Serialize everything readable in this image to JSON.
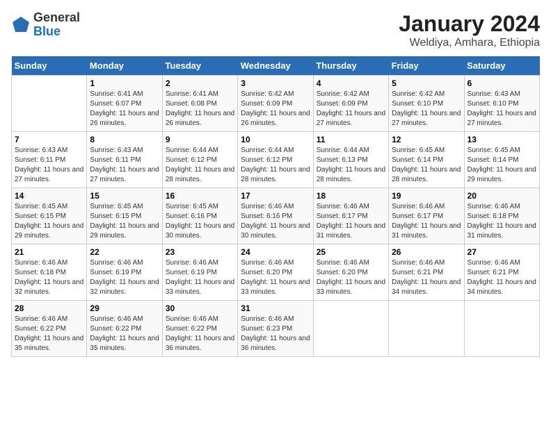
{
  "logo": {
    "general": "General",
    "blue": "Blue"
  },
  "title": "January 2024",
  "subtitle": "Weldiya, Amhara, Ethiopia",
  "days_of_week": [
    "Sunday",
    "Monday",
    "Tuesday",
    "Wednesday",
    "Thursday",
    "Friday",
    "Saturday"
  ],
  "weeks": [
    [
      {
        "day": "",
        "sunrise": "",
        "sunset": "",
        "daylight": ""
      },
      {
        "day": "1",
        "sunrise": "Sunrise: 6:41 AM",
        "sunset": "Sunset: 6:07 PM",
        "daylight": "Daylight: 11 hours and 26 minutes."
      },
      {
        "day": "2",
        "sunrise": "Sunrise: 6:41 AM",
        "sunset": "Sunset: 6:08 PM",
        "daylight": "Daylight: 11 hours and 26 minutes."
      },
      {
        "day": "3",
        "sunrise": "Sunrise: 6:42 AM",
        "sunset": "Sunset: 6:09 PM",
        "daylight": "Daylight: 11 hours and 26 minutes."
      },
      {
        "day": "4",
        "sunrise": "Sunrise: 6:42 AM",
        "sunset": "Sunset: 6:09 PM",
        "daylight": "Daylight: 11 hours and 27 minutes."
      },
      {
        "day": "5",
        "sunrise": "Sunrise: 6:42 AM",
        "sunset": "Sunset: 6:10 PM",
        "daylight": "Daylight: 11 hours and 27 minutes."
      },
      {
        "day": "6",
        "sunrise": "Sunrise: 6:43 AM",
        "sunset": "Sunset: 6:10 PM",
        "daylight": "Daylight: 11 hours and 27 minutes."
      }
    ],
    [
      {
        "day": "7",
        "sunrise": "Sunrise: 6:43 AM",
        "sunset": "Sunset: 6:11 PM",
        "daylight": "Daylight: 11 hours and 27 minutes."
      },
      {
        "day": "8",
        "sunrise": "Sunrise: 6:43 AM",
        "sunset": "Sunset: 6:11 PM",
        "daylight": "Daylight: 11 hours and 27 minutes."
      },
      {
        "day": "9",
        "sunrise": "Sunrise: 6:44 AM",
        "sunset": "Sunset: 6:12 PM",
        "daylight": "Daylight: 11 hours and 28 minutes."
      },
      {
        "day": "10",
        "sunrise": "Sunrise: 6:44 AM",
        "sunset": "Sunset: 6:12 PM",
        "daylight": "Daylight: 11 hours and 28 minutes."
      },
      {
        "day": "11",
        "sunrise": "Sunrise: 6:44 AM",
        "sunset": "Sunset: 6:13 PM",
        "daylight": "Daylight: 11 hours and 28 minutes."
      },
      {
        "day": "12",
        "sunrise": "Sunrise: 6:45 AM",
        "sunset": "Sunset: 6:14 PM",
        "daylight": "Daylight: 11 hours and 28 minutes."
      },
      {
        "day": "13",
        "sunrise": "Sunrise: 6:45 AM",
        "sunset": "Sunset: 6:14 PM",
        "daylight": "Daylight: 11 hours and 29 minutes."
      }
    ],
    [
      {
        "day": "14",
        "sunrise": "Sunrise: 6:45 AM",
        "sunset": "Sunset: 6:15 PM",
        "daylight": "Daylight: 11 hours and 29 minutes."
      },
      {
        "day": "15",
        "sunrise": "Sunrise: 6:45 AM",
        "sunset": "Sunset: 6:15 PM",
        "daylight": "Daylight: 11 hours and 29 minutes."
      },
      {
        "day": "16",
        "sunrise": "Sunrise: 6:45 AM",
        "sunset": "Sunset: 6:16 PM",
        "daylight": "Daylight: 11 hours and 30 minutes."
      },
      {
        "day": "17",
        "sunrise": "Sunrise: 6:46 AM",
        "sunset": "Sunset: 6:16 PM",
        "daylight": "Daylight: 11 hours and 30 minutes."
      },
      {
        "day": "18",
        "sunrise": "Sunrise: 6:46 AM",
        "sunset": "Sunset: 6:17 PM",
        "daylight": "Daylight: 11 hours and 31 minutes."
      },
      {
        "day": "19",
        "sunrise": "Sunrise: 6:46 AM",
        "sunset": "Sunset: 6:17 PM",
        "daylight": "Daylight: 11 hours and 31 minutes."
      },
      {
        "day": "20",
        "sunrise": "Sunrise: 6:46 AM",
        "sunset": "Sunset: 6:18 PM",
        "daylight": "Daylight: 11 hours and 31 minutes."
      }
    ],
    [
      {
        "day": "21",
        "sunrise": "Sunrise: 6:46 AM",
        "sunset": "Sunset: 6:18 PM",
        "daylight": "Daylight: 11 hours and 32 minutes."
      },
      {
        "day": "22",
        "sunrise": "Sunrise: 6:46 AM",
        "sunset": "Sunset: 6:19 PM",
        "daylight": "Daylight: 11 hours and 32 minutes."
      },
      {
        "day": "23",
        "sunrise": "Sunrise: 6:46 AM",
        "sunset": "Sunset: 6:19 PM",
        "daylight": "Daylight: 11 hours and 33 minutes."
      },
      {
        "day": "24",
        "sunrise": "Sunrise: 6:46 AM",
        "sunset": "Sunset: 6:20 PM",
        "daylight": "Daylight: 11 hours and 33 minutes."
      },
      {
        "day": "25",
        "sunrise": "Sunrise: 6:46 AM",
        "sunset": "Sunset: 6:20 PM",
        "daylight": "Daylight: 11 hours and 33 minutes."
      },
      {
        "day": "26",
        "sunrise": "Sunrise: 6:46 AM",
        "sunset": "Sunset: 6:21 PM",
        "daylight": "Daylight: 11 hours and 34 minutes."
      },
      {
        "day": "27",
        "sunrise": "Sunrise: 6:46 AM",
        "sunset": "Sunset: 6:21 PM",
        "daylight": "Daylight: 11 hours and 34 minutes."
      }
    ],
    [
      {
        "day": "28",
        "sunrise": "Sunrise: 6:46 AM",
        "sunset": "Sunset: 6:22 PM",
        "daylight": "Daylight: 11 hours and 35 minutes."
      },
      {
        "day": "29",
        "sunrise": "Sunrise: 6:46 AM",
        "sunset": "Sunset: 6:22 PM",
        "daylight": "Daylight: 11 hours and 35 minutes."
      },
      {
        "day": "30",
        "sunrise": "Sunrise: 6:46 AM",
        "sunset": "Sunset: 6:22 PM",
        "daylight": "Daylight: 11 hours and 36 minutes."
      },
      {
        "day": "31",
        "sunrise": "Sunrise: 6:46 AM",
        "sunset": "Sunset: 6:23 PM",
        "daylight": "Daylight: 11 hours and 36 minutes."
      },
      {
        "day": "",
        "sunrise": "",
        "sunset": "",
        "daylight": ""
      },
      {
        "day": "",
        "sunrise": "",
        "sunset": "",
        "daylight": ""
      },
      {
        "day": "",
        "sunrise": "",
        "sunset": "",
        "daylight": ""
      }
    ]
  ]
}
